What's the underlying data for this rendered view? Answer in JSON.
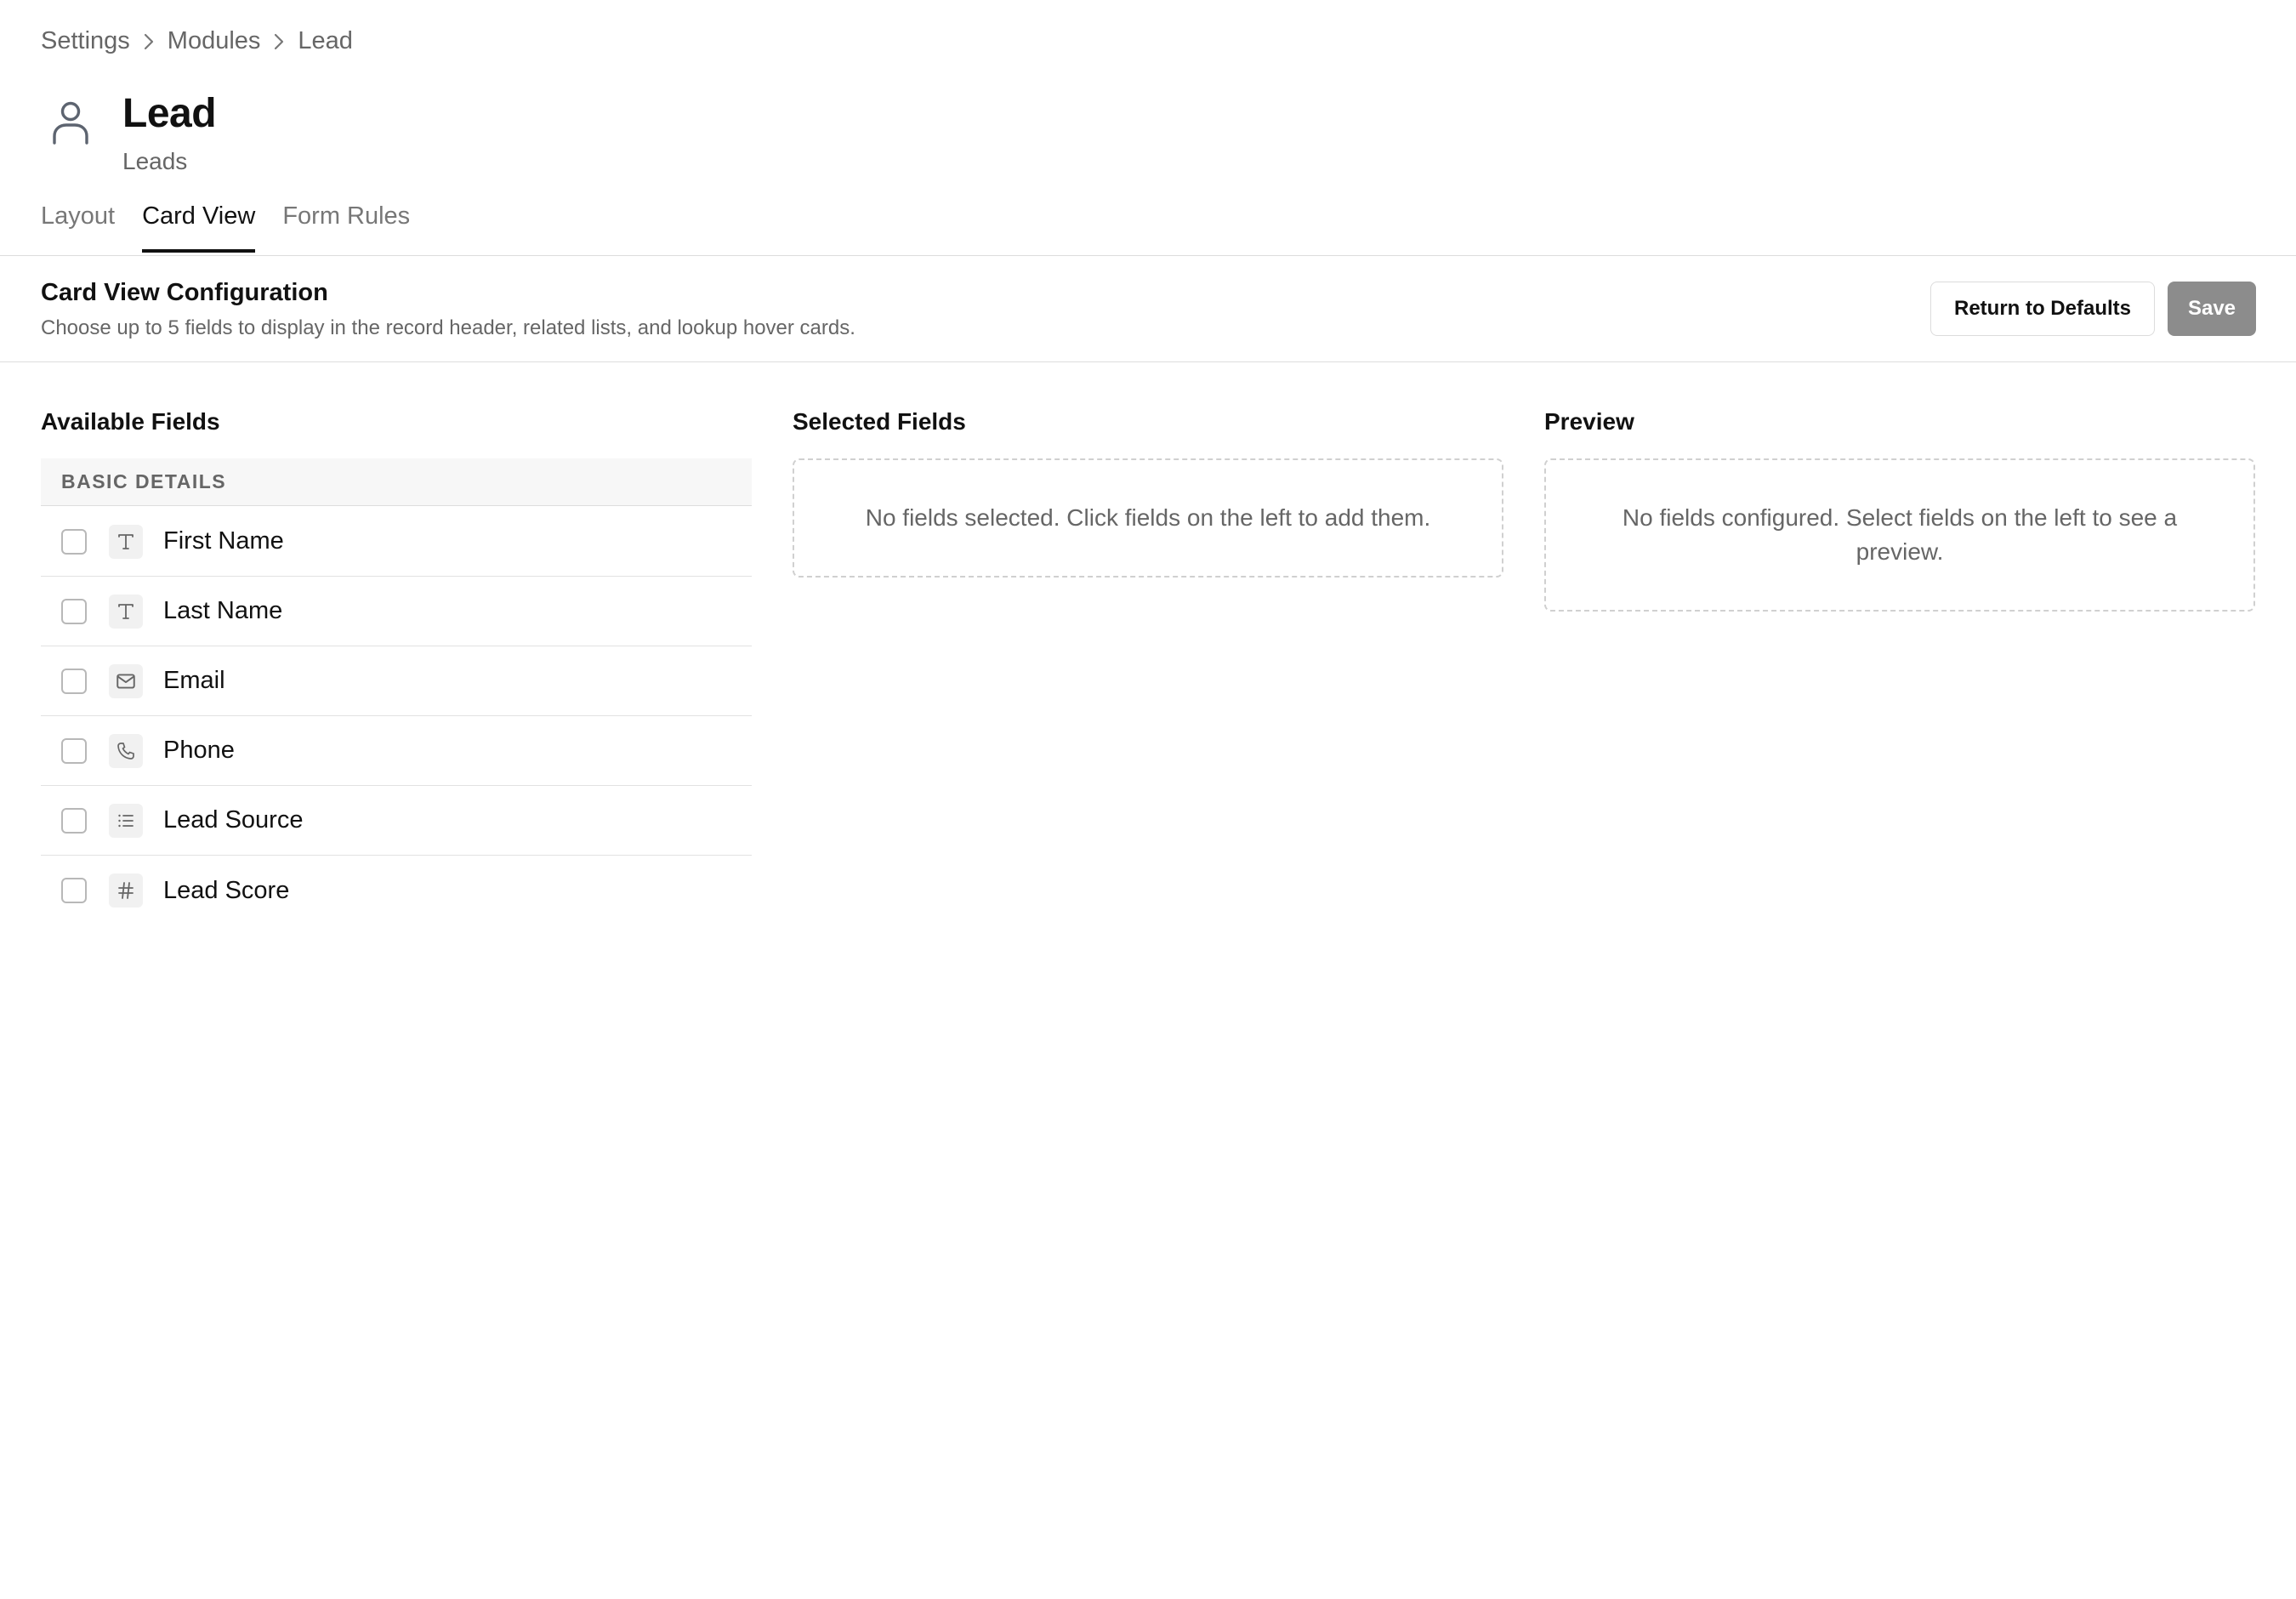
{
  "breadcrumb": [
    "Settings",
    "Modules",
    "Lead"
  ],
  "module": {
    "icon": "user-icon",
    "title": "Lead",
    "subtitle": "Leads"
  },
  "tabs": [
    {
      "label": "Layout",
      "active": false
    },
    {
      "label": "Card View",
      "active": true
    },
    {
      "label": "Form Rules",
      "active": false
    }
  ],
  "config": {
    "title": "Card View Configuration",
    "description": "Choose up to 5 fields to display in the record header, related lists, and lookup hover cards.",
    "return_button": "Return to Defaults",
    "save_button": "Save"
  },
  "available": {
    "title": "Available Fields",
    "group": "BASIC DETAILS",
    "fields": [
      {
        "label": "First Name",
        "icon": "text-type-icon",
        "checked": false
      },
      {
        "label": "Last Name",
        "icon": "text-type-icon",
        "checked": false
      },
      {
        "label": "Email",
        "icon": "mail-icon",
        "checked": false
      },
      {
        "label": "Phone",
        "icon": "phone-icon",
        "checked": false
      },
      {
        "label": "Lead Source",
        "icon": "list-icon",
        "checked": false
      },
      {
        "label": "Lead Score",
        "icon": "hash-icon",
        "checked": false
      }
    ]
  },
  "selected": {
    "title": "Selected Fields",
    "empty_text": "No fields selected. Click fields on the left to add them."
  },
  "preview": {
    "title": "Preview",
    "empty_text": "No fields configured. Select fields on the left to see a preview."
  },
  "colors": {
    "text": "#111111",
    "muted": "#666666",
    "border": "#dddddd",
    "save_button_bg": "#8c8c8c"
  }
}
